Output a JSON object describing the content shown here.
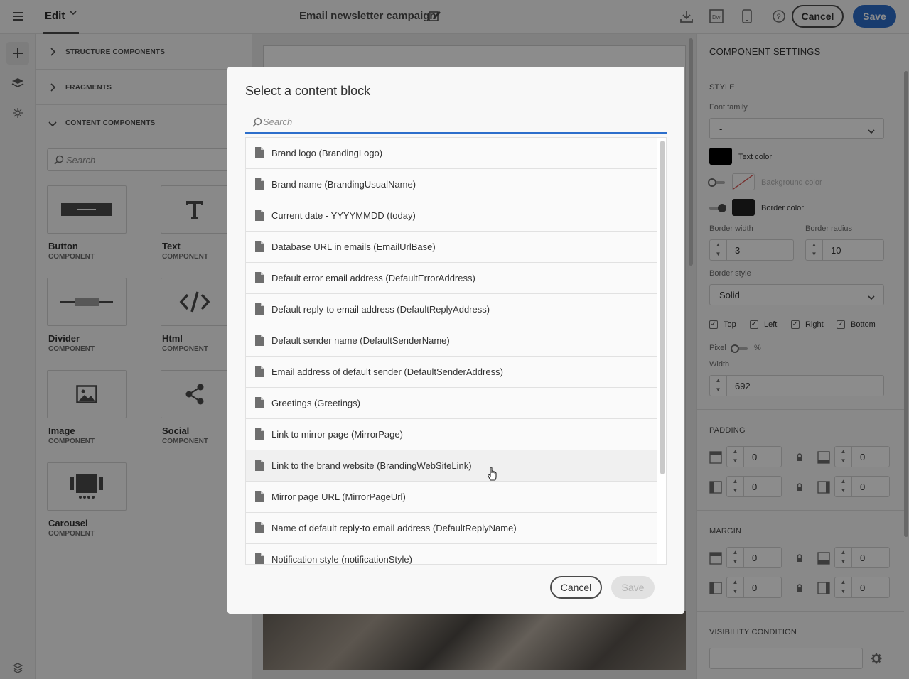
{
  "topbar": {
    "mode_label": "Edit",
    "title": "Email newsletter campaign",
    "cancel_label": "Cancel",
    "save_label": "Save",
    "icons": [
      "menu-icon",
      "chevron-down-icon",
      "edit-title-icon",
      "download-icon",
      "dreamweaver-icon",
      "mobile-preview-icon",
      "help-icon"
    ]
  },
  "rail": {
    "icons": [
      "plus-icon",
      "layers-icon",
      "asset-icon",
      "navigator-icon"
    ]
  },
  "components_panel": {
    "sections": [
      {
        "label": "STRUCTURE COMPONENTS",
        "expanded": false
      },
      {
        "label": "FRAGMENTS",
        "expanded": false
      },
      {
        "label": "CONTENT COMPONENTS",
        "expanded": true
      }
    ],
    "search_placeholder": "Search",
    "tiles": [
      {
        "name": "Button",
        "type": "COMPONENT",
        "icon": "button-icon"
      },
      {
        "name": "Text",
        "type": "COMPONENT",
        "icon": "text-icon"
      },
      {
        "name": "Divider",
        "type": "COMPONENT",
        "icon": "divider-icon"
      },
      {
        "name": "Html",
        "type": "COMPONENT",
        "icon": "code-icon"
      },
      {
        "name": "Image",
        "type": "COMPONENT",
        "icon": "image-icon"
      },
      {
        "name": "Social",
        "type": "COMPONENT",
        "icon": "share-icon"
      },
      {
        "name": "Carousel",
        "type": "COMPONENT",
        "icon": "carousel-icon"
      }
    ]
  },
  "settings": {
    "header": "COMPONENT SETTINGS",
    "style_section": "STYLE",
    "font_family_label": "Font family",
    "font_family_value": "-",
    "text_color_label": "Text color",
    "text_color": "#000000",
    "background_color_label": "Background color",
    "border_color_label": "Border color",
    "border_color": "#222222",
    "border_width_label": "Border width",
    "border_width_value": "3",
    "border_radius_label": "Border radius",
    "border_radius_value": "10",
    "border_style_label": "Border style",
    "border_style_value": "Solid",
    "sides": [
      {
        "label": "Top",
        "checked": true
      },
      {
        "label": "Left",
        "checked": true
      },
      {
        "label": "Right",
        "checked": true
      },
      {
        "label": "Bottom",
        "checked": true
      }
    ],
    "unit_left": "Pixel",
    "unit_right": "%",
    "width_label": "Width",
    "width_value": "692",
    "padding_section": "PADDING",
    "padding_values": [
      "0",
      "0",
      "0",
      "0"
    ],
    "margin_section": "MARGIN",
    "margin_values": [
      "0",
      "0",
      "0",
      "0"
    ],
    "visibility_section": "VISIBILITY CONDITION"
  },
  "modal": {
    "title": "Select a content block",
    "search_placeholder": "Search",
    "items": [
      "Brand logo (BrandingLogo)",
      "Brand name (BrandingUsualName)",
      "Current date - YYYYMMDD (today)",
      "Database URL in emails (EmailUrlBase)",
      "Default error email address (DefaultErrorAddress)",
      "Default reply-to email address (DefaultReplyAddress)",
      "Default sender name (DefaultSenderName)",
      "Email address of default sender (DefaultSenderAddress)",
      "Greetings (Greetings)",
      "Link to mirror page (MirrorPage)",
      "Link to the brand website (BrandingWebSiteLink)",
      "Mirror page URL (MirrorPageUrl)",
      "Name of default reply-to email address (DefaultReplyName)",
      "Notification style (notificationStyle)"
    ],
    "hovered_index": 10,
    "cancel_label": "Cancel",
    "save_label": "Save"
  },
  "colors": {
    "accent": "#2c6ecb",
    "overlay": "rgba(0,0,0,0.45)"
  }
}
